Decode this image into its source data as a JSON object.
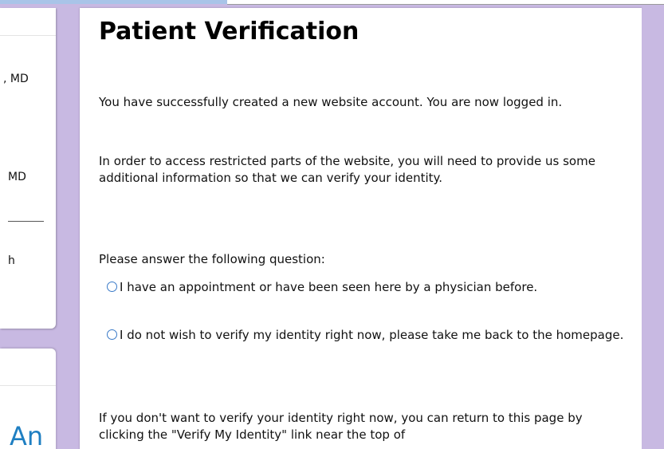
{
  "sidebar": {
    "line1": ", MD",
    "line2": " MD",
    "line3": "h",
    "big": "An"
  },
  "main": {
    "title": "Patient Verification",
    "p1": "You have successfully created a new website account. You are now logged in.",
    "p2": "In order to access restricted parts of the website, you will need to provide us some additional information so that we can verify your identity.",
    "question": "Please answer the following question:",
    "options": [
      "I have an appointment or have been seen here by a physician before.",
      "I do not wish to verify my identity right now, please take me back to the homepage."
    ],
    "p3": "If you don't want to verify your identity right now, you can return to this page by clicking the \"Verify My Identity\" link near the top of"
  },
  "colors": {
    "background": "#c8b9e2",
    "accent": "#1f7fc2"
  }
}
